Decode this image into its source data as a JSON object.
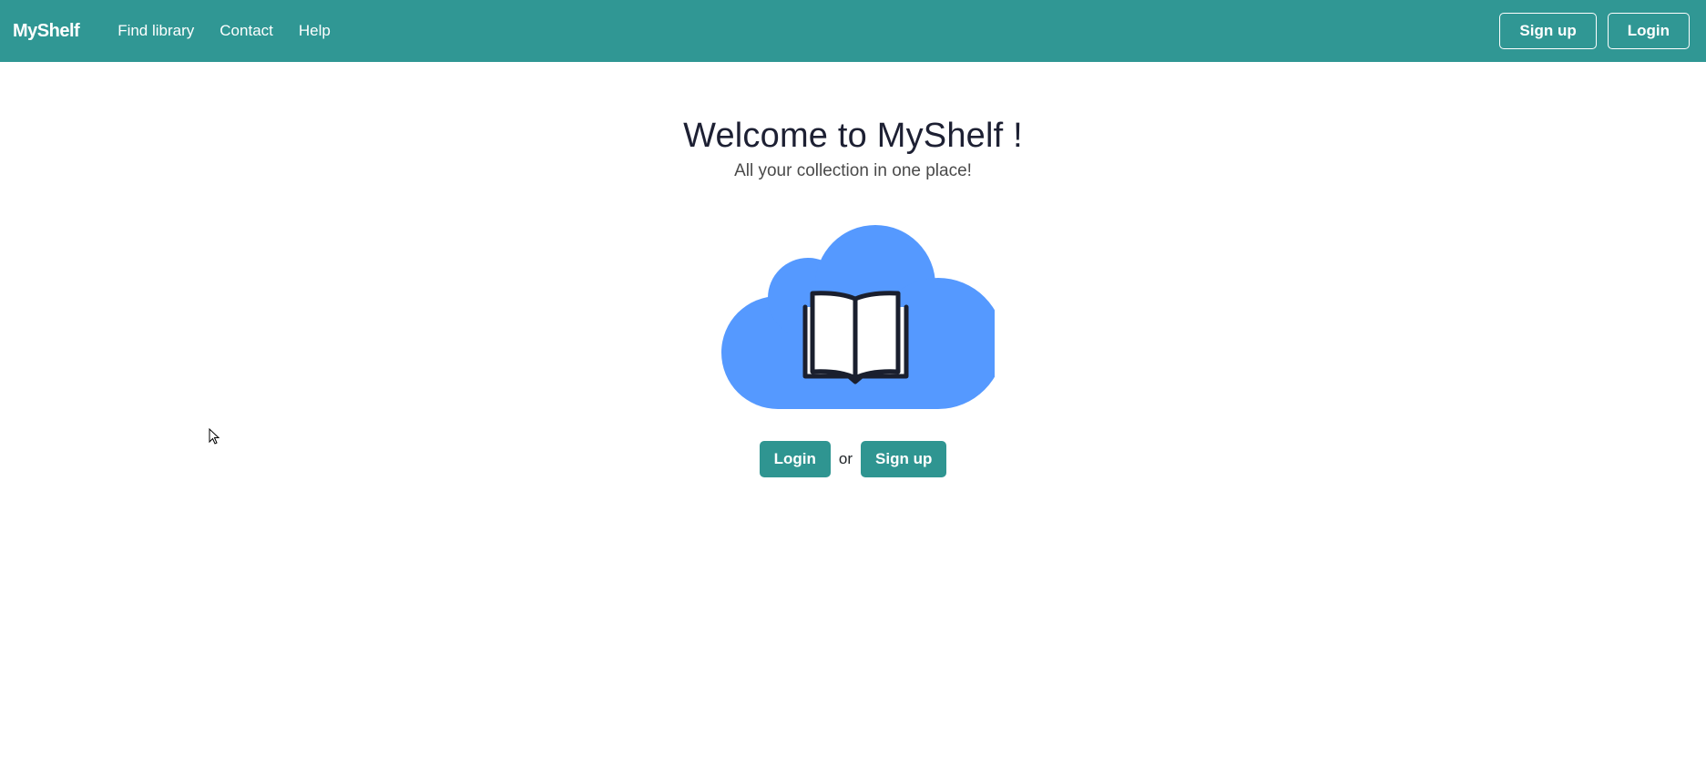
{
  "navbar": {
    "brand": "MyShelf",
    "links": [
      {
        "label": "Find library"
      },
      {
        "label": "Contact"
      },
      {
        "label": "Help"
      }
    ],
    "signup_label": "Sign up",
    "login_label": "Login",
    "color": "#309794"
  },
  "hero": {
    "title": "Welcome to MyShelf !",
    "subtitle": "All your collection in one place!",
    "illustration_icon": "cloud-book-icon",
    "cloud_color": "#5599ff"
  },
  "actions": {
    "login_label": "Login",
    "separator": "or",
    "signup_label": "Sign up",
    "button_color": "#2f9591"
  },
  "cursor_icon": "mouse-pointer-icon"
}
